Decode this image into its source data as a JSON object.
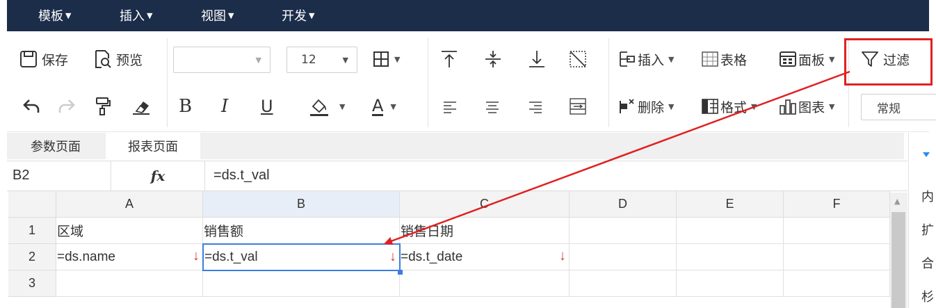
{
  "menu": [
    {
      "label": "模板"
    },
    {
      "label": "插入"
    },
    {
      "label": "视图"
    },
    {
      "label": "开发"
    }
  ],
  "toolbar": {
    "save_label": "保存",
    "preview_label": "预览",
    "font_size": "12",
    "insert_label": "插入",
    "table_label": "表格",
    "panel_label": "面板",
    "filter_label": "过滤",
    "delete_label": "删除",
    "format_label": "格式",
    "chart_label": "图表",
    "number_format": "常规",
    "bold": "B",
    "italic": "I",
    "underline": "U",
    "font_color": "A"
  },
  "tabs": [
    {
      "label": "参数页面"
    },
    {
      "label": "报表页面"
    }
  ],
  "formula_bar": {
    "cell_ref": "B2",
    "fx": "fx",
    "value": "=ds.t_val"
  },
  "grid": {
    "columns": [
      "A",
      "B",
      "C",
      "D",
      "E",
      "F"
    ],
    "rows": [
      "1",
      "2",
      "3"
    ],
    "cells": {
      "A1": "区域",
      "B1": "销售额",
      "C1": "销售日期",
      "A2": "=ds.name",
      "B2": "=ds.t_val",
      "C2": "=ds.t_date",
      "expand_arrow": "↓"
    }
  },
  "right_panel": [
    "内",
    "扩",
    "合",
    "杉"
  ],
  "colors": {
    "menubar": "#1c2d4a",
    "highlight": "#e02020",
    "selection": "#3d7de0",
    "expand_arrow": "#d23a3a"
  }
}
